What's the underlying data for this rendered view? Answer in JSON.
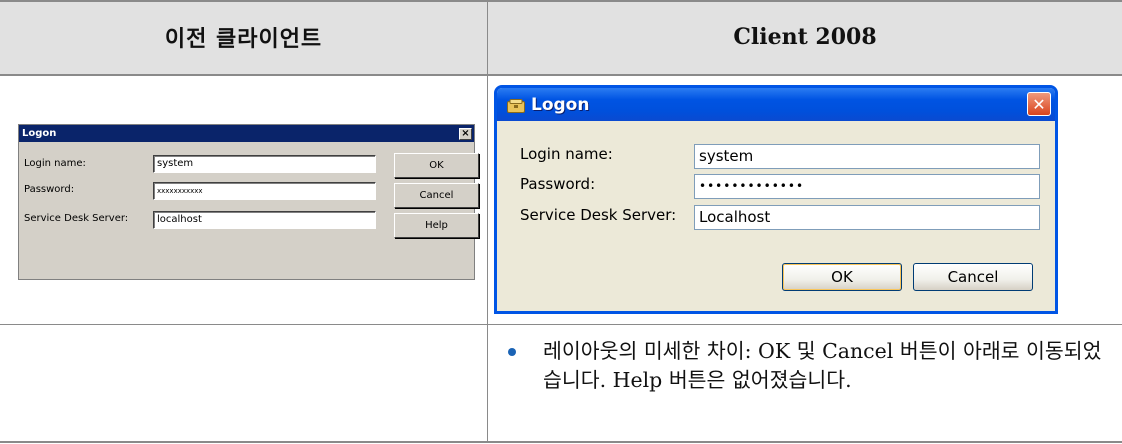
{
  "table": {
    "headers": [
      "이전 클라이언트",
      "Client 2008"
    ]
  },
  "old_dialog": {
    "title": "Logon",
    "close_glyph": "×",
    "labels": {
      "login_name": "Login name:",
      "password": "Password:",
      "server": "Service Desk Server:"
    },
    "values": {
      "login_name": "system",
      "password": "xxxxxxxxxxx",
      "server": "localhost"
    },
    "buttons": {
      "ok": "OK",
      "cancel": "Cancel",
      "help": "Help"
    }
  },
  "new_dialog": {
    "title": "Logon",
    "close_glyph": "✕",
    "labels": {
      "login_name": "Login name:",
      "password": "Password:",
      "server": "Service Desk Server:"
    },
    "values": {
      "login_name": "system",
      "password": "•••••••••••••",
      "server": "Localhost"
    },
    "buttons": {
      "ok": "OK",
      "cancel": "Cancel"
    },
    "colors": {
      "titlebar": "#0054e3",
      "close": "#d9441e",
      "body": "#ece9d8"
    }
  },
  "note": {
    "text": "레이아웃의 미세한 차이: OK 및 Cancel 버튼이 아래로 이동되었습니다. Help 버튼은 없어졌습니다.",
    "bullet_color": "#1a63b5"
  }
}
